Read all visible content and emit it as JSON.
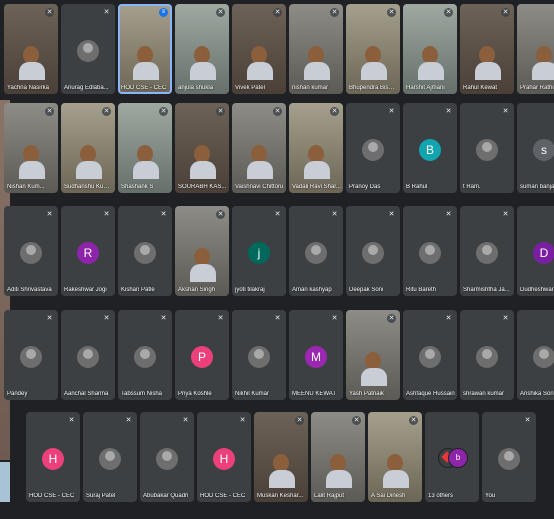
{
  "colors": {
    "background": "#202124",
    "tile": "#3c4043",
    "speaking_accent": "#1a73e8",
    "active_border": "#8ab4f8"
  },
  "rows": [
    [
      {
        "name": "Yachna Nasirka",
        "type": "video"
      },
      {
        "name": "Anurag Edlaba...",
        "type": "photo"
      },
      {
        "name": "HOD CSE - CEC",
        "type": "video",
        "speaking": true
      },
      {
        "name": "anjula shukla",
        "type": "video"
      },
      {
        "name": "Vivek Patel",
        "type": "video"
      },
      {
        "name": "nishan kumar",
        "type": "video"
      },
      {
        "name": "Bhupendra Biswas",
        "type": "video"
      },
      {
        "name": "Harshit Ajmani",
        "type": "video"
      },
      {
        "name": "Rahul Kewat",
        "type": "video"
      },
      {
        "name": "Prahar Rathore",
        "type": "video"
      }
    ],
    [
      {
        "name": "Nishan Kum...",
        "type": "video"
      },
      {
        "name": "Sudhanshu Kumar",
        "type": "video"
      },
      {
        "name": "Shashank S",
        "type": "video"
      },
      {
        "name": "SOURABH KAS...",
        "type": "video"
      },
      {
        "name": "Vaishnavi Chittoru",
        "type": "video"
      },
      {
        "name": "Vadali Ravi Shar...",
        "type": "video"
      },
      {
        "name": "Pranoy Das",
        "type": "photo"
      },
      {
        "name": "B Rahul",
        "type": "letter",
        "letter": "B",
        "color": "#12a4af"
      },
      {
        "name": "t Ram.",
        "type": "photo"
      },
      {
        "name": "suman banjare",
        "type": "letter",
        "letter": "s",
        "color": "#5f6368"
      }
    ],
    [
      {
        "name": "Aditi Shrivastava",
        "type": "photo"
      },
      {
        "name": "Rakeshwar Jogi",
        "type": "letter",
        "letter": "R",
        "color": "#8e24aa"
      },
      {
        "name": "Kishan Patle",
        "type": "photo"
      },
      {
        "name": "Akshan Singh",
        "type": "video"
      },
      {
        "name": "jyoti tilakraj",
        "type": "letter",
        "letter": "j",
        "color": "#00695c"
      },
      {
        "name": "Aman kashyap",
        "type": "photo"
      },
      {
        "name": "Deepak Soni",
        "type": "photo"
      },
      {
        "name": "Ritu Bareth",
        "type": "photo"
      },
      {
        "name": "Sharmishtha Ja...",
        "type": "photo"
      },
      {
        "name": "Dudheshwar P",
        "type": "letter",
        "letter": "D",
        "color": "#7b1fa2"
      }
    ],
    [
      {
        "name": "Pandey",
        "type": "photo"
      },
      {
        "name": "Aanchal Sharma",
        "type": "photo"
      },
      {
        "name": "Tabssum Nisha",
        "type": "photo"
      },
      {
        "name": "Priya Koshle",
        "type": "letter",
        "letter": "P",
        "color": "#ec407a"
      },
      {
        "name": "Nikhil Kumar",
        "type": "photo"
      },
      {
        "name": "MEENU KEWAT",
        "type": "letter",
        "letter": "M",
        "color": "#9c27b0"
      },
      {
        "name": "Yash Patnaik",
        "type": "video"
      },
      {
        "name": "Ashfaque Hussain",
        "type": "photo"
      },
      {
        "name": "shrawan kumar",
        "type": "photo"
      },
      {
        "name": "Anshika Soni",
        "type": "photo"
      }
    ],
    [
      {
        "name": "HOD CSE - CEC",
        "type": "letter",
        "letter": "H",
        "color": "#ec407a"
      },
      {
        "name": "Suraj Patel",
        "type": "photo"
      },
      {
        "name": "Abubakar Quadri",
        "type": "photo"
      },
      {
        "name": "HOD CSE - CEC",
        "type": "letter",
        "letter": "H",
        "color": "#ec407a"
      },
      {
        "name": "Muskan Keshar...",
        "type": "video"
      },
      {
        "name": "Lalit Rajput",
        "type": "video"
      },
      {
        "name": "A Sai Dinesh",
        "type": "video"
      },
      {
        "name": "13 others",
        "type": "others"
      },
      {
        "name": "You",
        "type": "photo"
      }
    ]
  ]
}
